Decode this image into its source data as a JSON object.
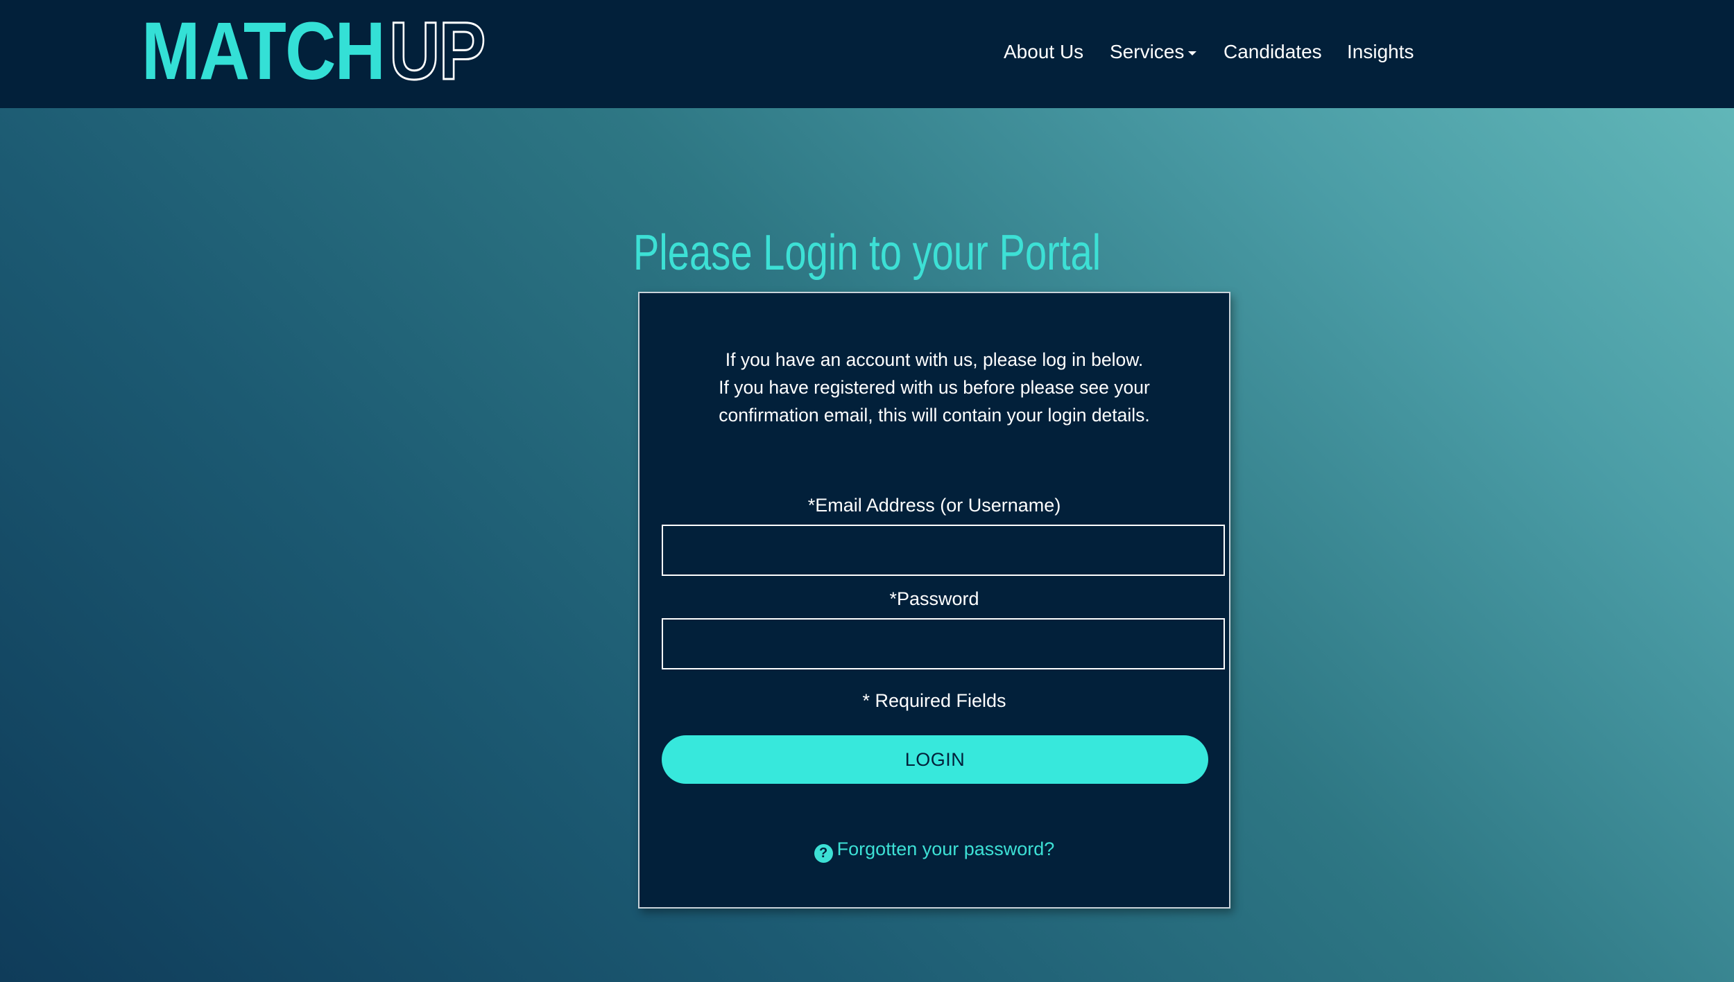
{
  "brand": {
    "logo_solid": "MATCH",
    "logo_outline": "UP",
    "accent_color": "#34e0d6",
    "nav_background": "#02203a"
  },
  "nav": {
    "about": "About Us",
    "services": "Services",
    "candidates": "Candidates",
    "insights": "Insights"
  },
  "page": {
    "title": "Please Login to your Portal"
  },
  "login_card": {
    "intro_line1": "If you have an account with us, please log in below.",
    "intro_line2": "If you have registered with us before please see your confirmation email, this will contain your login details.",
    "email_label": "*Email Address (or Username)",
    "email_value": "",
    "password_label": "*Password",
    "password_value": "",
    "required_note": "* Required Fields",
    "login_button": "LOGIN",
    "forgot_link": "Forgotten your password?",
    "forgot_icon": "question-circle-icon"
  }
}
